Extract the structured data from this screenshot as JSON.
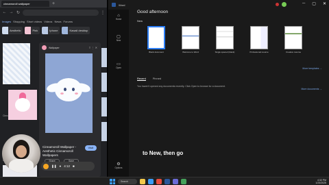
{
  "browser": {
    "tabs": [
      {
        "label": "cinnamoroll wallpaper"
      }
    ],
    "nav": {
      "back": "←",
      "forward": "→",
      "reload": "↻",
      "menu": "⋮"
    },
    "gtabs": [
      "Images",
      "Shopping",
      "Short videos",
      "Videos",
      "News",
      "Forums"
    ],
    "chips": [
      "Aesthetic",
      "Pink",
      "Iphone",
      "Kawaii desktop"
    ],
    "results": [
      {
        "caption": "Cinnamoroll Wallpaper - ..."
      },
      {
        "caption": "Cinnamoroll Wallpapers - Top ..."
      }
    ],
    "preview": {
      "site": "Wallpaper",
      "title": "Cinnamoroll Wallpaper - Aesthetic Cinnamoroll Wallpapers",
      "visit": "Visit",
      "share": "Share",
      "save": "Save"
    }
  },
  "recorder": {
    "time": "4:12"
  },
  "word": {
    "app_title": "Word",
    "greeting": "Good afternoon",
    "new_label": "New",
    "templates": [
      {
        "name": "Blank document"
      },
      {
        "name": "Welcome to Word"
      },
      {
        "name": "Single spaced (blank)"
      },
      {
        "name": "Professional resume"
      },
      {
        "name": "Creative resume"
      }
    ],
    "more_templates": "More templates →",
    "recent_tabs": [
      "Recent",
      "Pinned"
    ],
    "empty_message": "You haven't opened any documents recently. Click Open to browse for a document.",
    "more_files": "More documents →",
    "sidebar": [
      {
        "icon": "⌂",
        "label": "Home"
      },
      {
        "icon": "▢",
        "label": "New"
      },
      {
        "icon": "▭",
        "label": "Open"
      },
      {
        "icon": "⚙",
        "label": "Options"
      }
    ]
  },
  "caption": "to New, then go",
  "taskbar": {
    "search": "Search",
    "time": "4:32 PM",
    "date": "1/23/2025"
  },
  "colors": {
    "word_blue": "#2b579a",
    "accent": "#2d7ff9",
    "link": "#7aa7e8"
  }
}
